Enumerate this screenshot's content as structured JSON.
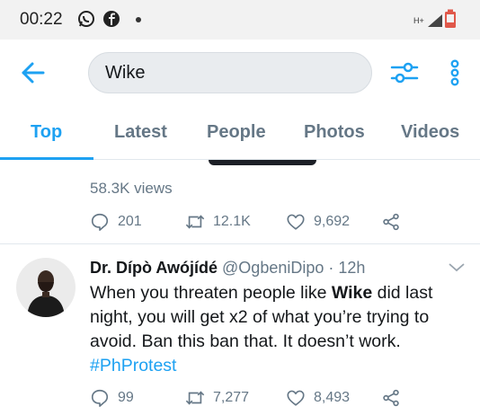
{
  "status_bar": {
    "time": "00:22",
    "icons": [
      "whatsapp-icon",
      "facebook-icon",
      "signal-icon",
      "battery-icon"
    ],
    "network_label": "H+"
  },
  "header": {
    "back_icon": "arrow-left-icon",
    "search_value": "Wike",
    "filter_icon": "sliders-icon",
    "more_icon": "vertical-dots-icon"
  },
  "tabs": [
    {
      "label": "Top",
      "active": true
    },
    {
      "label": "Latest",
      "active": false
    },
    {
      "label": "People",
      "active": false
    },
    {
      "label": "Photos",
      "active": false
    },
    {
      "label": "Videos",
      "active": false
    }
  ],
  "tweets": [
    {
      "views": "58.3K views",
      "replies": "201",
      "retweets": "12.1K",
      "likes": "9,692"
    },
    {
      "author_name": "Dr. Dípò Awójídé",
      "handle": "@OgbeniDipo",
      "separator": "·",
      "time": "12h",
      "text_before": "When you threaten people like ",
      "text_bold": "Wike",
      "text_after": " did last night, you will get x2 of what you’re trying to avoid. Ban this ban that. It doesn’t work.",
      "hashtag": "#PhProtest",
      "replies": "99",
      "retweets": "7,277",
      "likes": "8,493"
    }
  ],
  "colors": {
    "accent": "#1da1f2",
    "muted_text": "#657786",
    "main_text": "#14171a"
  }
}
